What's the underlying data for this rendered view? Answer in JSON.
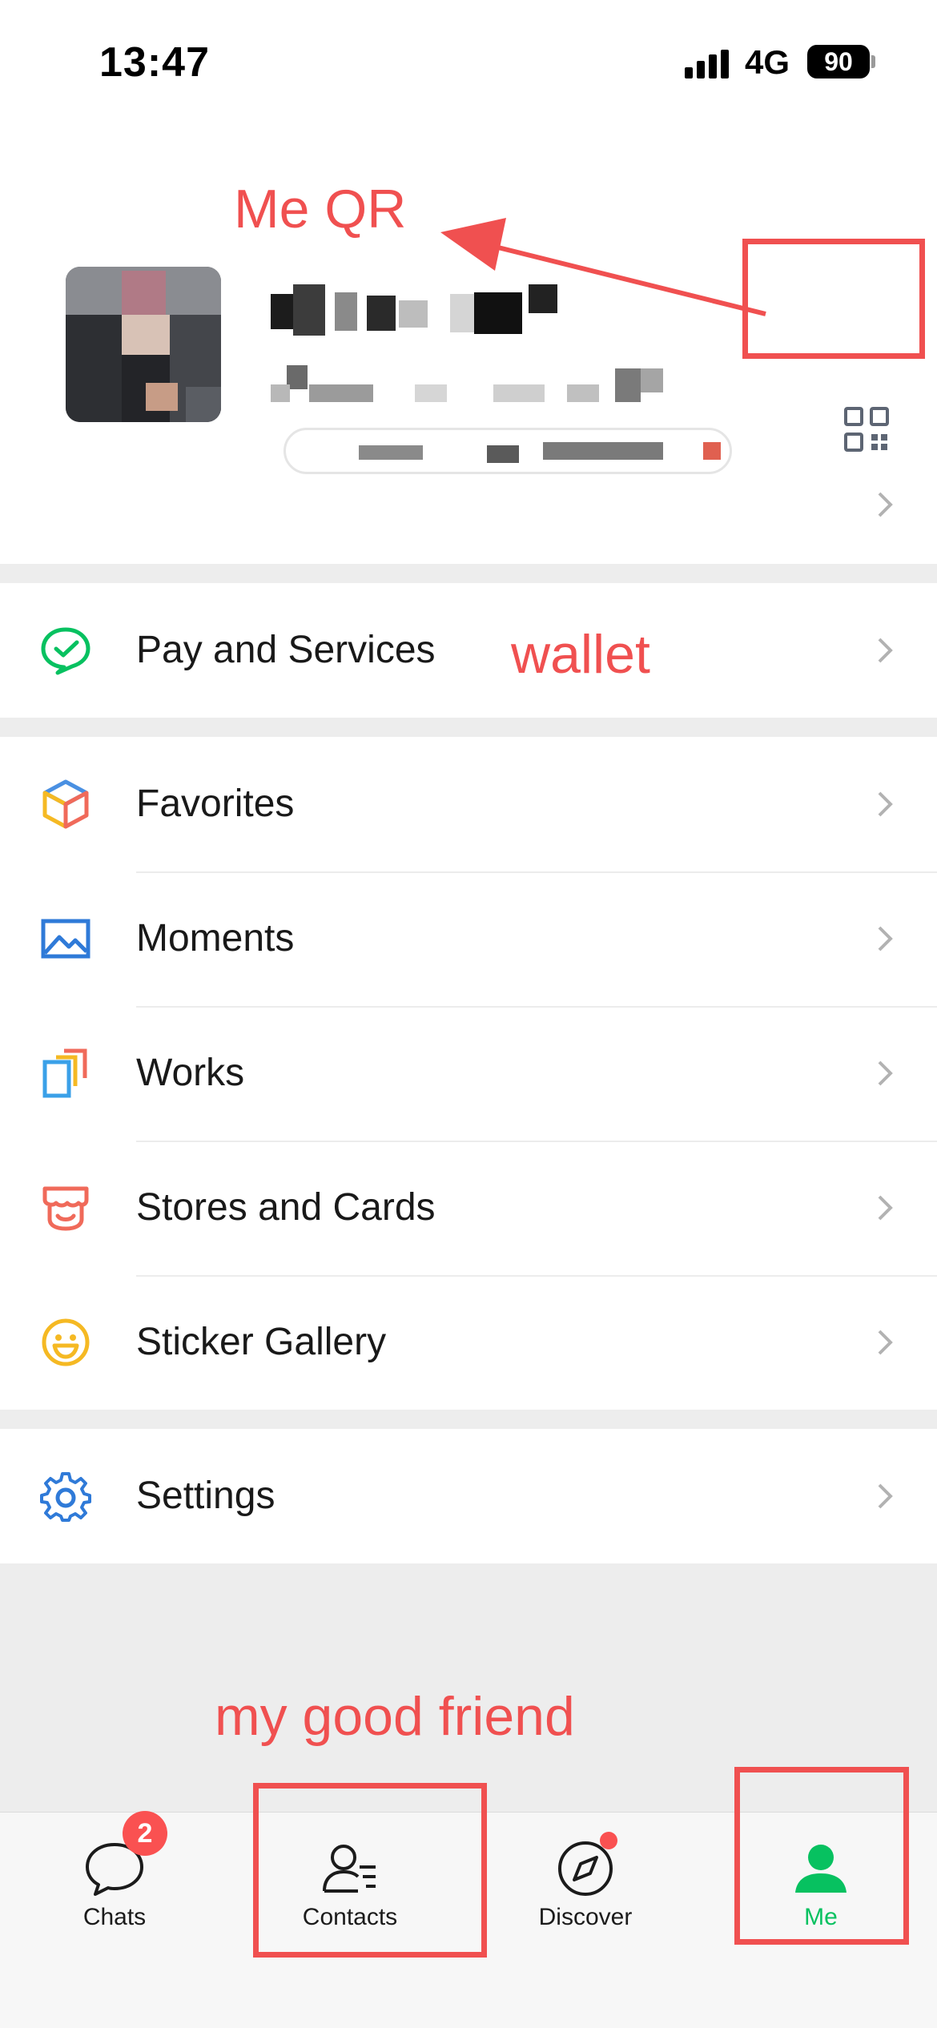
{
  "status_bar": {
    "time": "13:47",
    "network": "4G",
    "battery": "90"
  },
  "profile": {
    "name": "",
    "wechat_id": "",
    "status": ""
  },
  "groups": [
    {
      "items": [
        {
          "label": "Pay and Services",
          "icon": "pay-services-icon"
        }
      ]
    },
    {
      "items": [
        {
          "label": "Favorites",
          "icon": "favorites-cube-icon"
        },
        {
          "label": "Moments",
          "icon": "moments-picture-icon"
        },
        {
          "label": "Works",
          "icon": "works-icon"
        },
        {
          "label": "Stores and Cards",
          "icon": "store-icon"
        },
        {
          "label": "Sticker Gallery",
          "icon": "smiley-icon"
        }
      ]
    },
    {
      "items": [
        {
          "label": "Settings",
          "icon": "gear-icon"
        }
      ]
    }
  ],
  "tabs": [
    {
      "label": "Chats",
      "icon": "chat-bubble-icon",
      "badge": "2"
    },
    {
      "label": "Contacts",
      "icon": "contacts-icon"
    },
    {
      "label": "Discover",
      "icon": "compass-icon",
      "dot": true
    },
    {
      "label": "Me",
      "icon": "person-icon",
      "active": true
    }
  ],
  "colors": {
    "accent": "#07c160",
    "badge": "#fa5151",
    "annotation": "#f05050",
    "background": "#ededed"
  },
  "annotations": {
    "qr_note": "Me QR",
    "wallet_note": "wallet",
    "friend_note": "my good friend"
  }
}
